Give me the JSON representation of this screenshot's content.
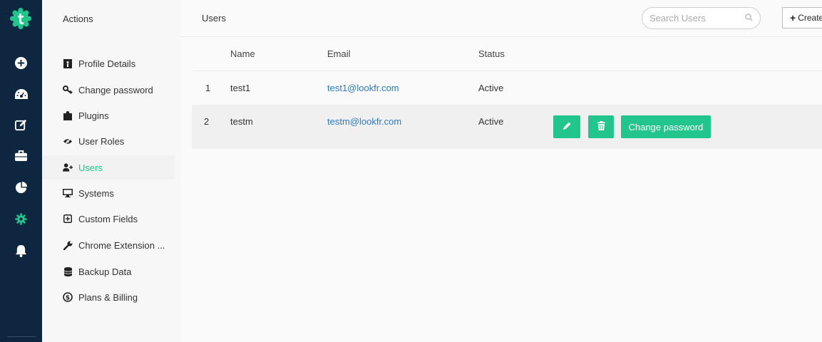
{
  "rail": {
    "icons": [
      "logo-icon",
      "plus-circle-icon",
      "dashboard-icon",
      "edit-icon",
      "briefcase-icon",
      "pie-chart-icon",
      "gear-icon",
      "bell-icon"
    ],
    "active_color": "#22c58b"
  },
  "settings": {
    "header": "Actions",
    "items": [
      {
        "label": "Profile Details",
        "icon": "id-card-icon"
      },
      {
        "label": "Change password",
        "icon": "key-icon"
      },
      {
        "label": "Plugins",
        "icon": "puzzle-icon"
      },
      {
        "label": "User Roles",
        "icon": "eye-slash-icon"
      },
      {
        "label": "Users",
        "icon": "user-plus-icon",
        "active": true
      },
      {
        "label": "Systems",
        "icon": "monitor-icon"
      },
      {
        "label": "Custom Fields",
        "icon": "plus-square-icon"
      },
      {
        "label": "Chrome Extension ...",
        "icon": "wrench-icon"
      },
      {
        "label": "Backup Data",
        "icon": "database-icon"
      },
      {
        "label": "Plans & Billing",
        "icon": "dollar-circle-icon"
      }
    ]
  },
  "main": {
    "title": "Users",
    "search_placeholder": "Search Users",
    "create_label": "Create",
    "columns": [
      "Name",
      "Email",
      "Status"
    ],
    "rows": [
      {
        "num": "1",
        "name": "test1",
        "email": "test1@lookfr.com",
        "status": "Active"
      },
      {
        "num": "2",
        "name": "testm",
        "email": "testm@lookfr.com",
        "status": "Active"
      }
    ],
    "actions": {
      "edit_icon": "pencil-icon",
      "delete_icon": "trash-icon",
      "change_password_label": "Change password"
    }
  },
  "colors": {
    "accent": "#22c58b",
    "link": "#2b7bc4",
    "rail": "#0f2640"
  }
}
